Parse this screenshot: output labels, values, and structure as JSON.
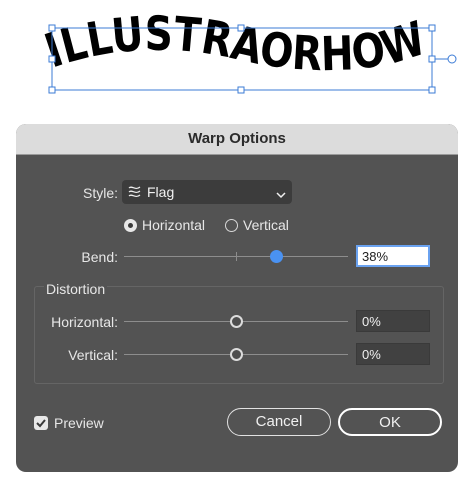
{
  "artwork": {
    "text": "ILLUSTRAORHOW"
  },
  "dialog": {
    "title": "Warp Options",
    "style": {
      "label": "Style:",
      "value": "Flag",
      "icon": "flag-warp-icon"
    },
    "orientation": {
      "horizontal_label": "Horizontal",
      "vertical_label": "Vertical",
      "selected": "Horizontal"
    },
    "bend": {
      "label": "Bend:",
      "value": "38%",
      "level": 38
    },
    "distortion": {
      "group_label": "Distortion",
      "horizontal": {
        "label": "Horizontal:",
        "value": "0%",
        "level": 0
      },
      "vertical": {
        "label": "Vertical:",
        "value": "0%",
        "level": 0
      }
    },
    "preview": {
      "label": "Preview",
      "checked": true
    },
    "buttons": {
      "cancel": "Cancel",
      "ok": "OK"
    }
  },
  "colors": {
    "accent": "#4a92f2",
    "dialog_bg": "#535353",
    "selection": "#3b7bd6"
  }
}
